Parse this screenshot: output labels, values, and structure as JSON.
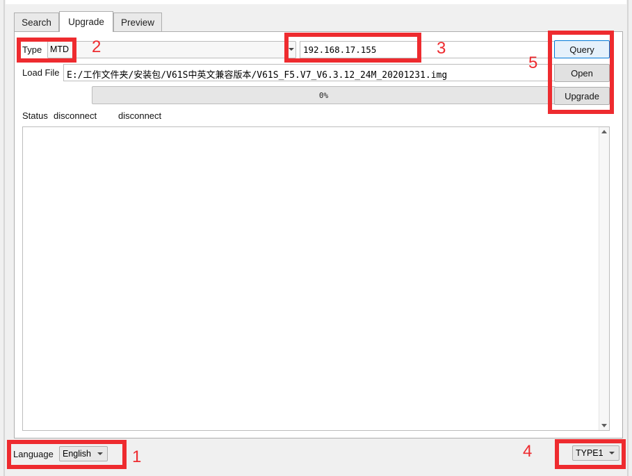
{
  "tabs": [
    {
      "label": "Search"
    },
    {
      "label": "Upgrade"
    },
    {
      "label": "Preview"
    }
  ],
  "form": {
    "type_label": "Type",
    "type_value": "MTD",
    "ip_value": "192.168.17.155",
    "load_file_label": "Load File",
    "file_path": "E:/工作文件夹/安装包/V61S中英文兼容版本/V61S_F5.V7_V6.3.12_24M_20201231.img",
    "progress_text": "0%",
    "progress_value": 0,
    "status_label": "Status",
    "status_value": "disconnect",
    "status_value_2": "disconnect"
  },
  "buttons": {
    "query": "Query",
    "open": "Open",
    "upgrade": "Upgrade"
  },
  "footer": {
    "language_label": "Language",
    "language_value": "English",
    "type_value": "TYPE1"
  },
  "annotations": {
    "n1": "1",
    "n2": "2",
    "n3": "3",
    "n4": "4",
    "n5": "5",
    "color": "#ee2b2f"
  }
}
